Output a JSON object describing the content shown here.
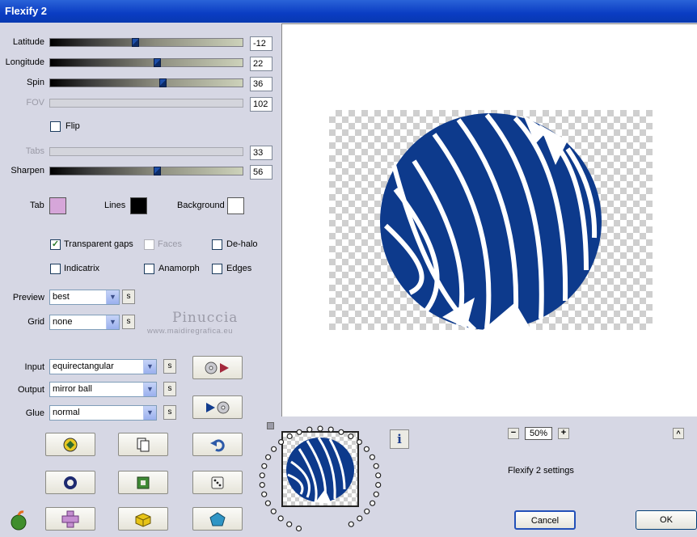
{
  "window": {
    "title": "Flexify 2"
  },
  "sliders": [
    {
      "label": "Latitude",
      "value": "-12",
      "fraction": 0.44,
      "enabled": true
    },
    {
      "label": "Longitude",
      "value": "22",
      "fraction": 0.56,
      "enabled": true
    },
    {
      "label": "Spin",
      "value": "36",
      "fraction": 0.59,
      "enabled": true
    },
    {
      "label": "FOV",
      "value": "102",
      "enabled": false
    },
    {
      "label": "Tabs",
      "value": "33",
      "enabled": false
    },
    {
      "label": "Sharpen",
      "value": "56",
      "fraction": 0.56,
      "enabled": true
    }
  ],
  "flip": {
    "label": "Flip",
    "checked": false
  },
  "colors": {
    "tab": {
      "label": "Tab",
      "value": "#d6a6d9"
    },
    "lines": {
      "label": "Lines",
      "value": "#000000"
    },
    "background": {
      "label": "Background",
      "value": "#ffffff"
    }
  },
  "options": {
    "transparent_gaps": {
      "label": "Transparent gaps",
      "checked": true
    },
    "faces": {
      "label": "Faces",
      "checked": false
    },
    "de_halo": {
      "label": "De-halo",
      "checked": false
    },
    "indicatrix": {
      "label": "Indicatrix",
      "checked": false
    },
    "anamorph": {
      "label": "Anamorph",
      "checked": false
    },
    "edges": {
      "label": "Edges",
      "checked": false
    }
  },
  "dropdowns": {
    "preview": {
      "label": "Preview",
      "value": "best"
    },
    "grid": {
      "label": "Grid",
      "value": "none"
    },
    "input": {
      "label": "Input",
      "value": "equirectangular"
    },
    "output": {
      "label": "Output",
      "value": "mirror ball"
    },
    "glue": {
      "label": "Glue",
      "value": "normal"
    }
  },
  "small_button_label": "s",
  "watermark": {
    "name": "Pinuccia",
    "site": "www.maidiregrafica.eu"
  },
  "zoom": {
    "value": "50%",
    "minus": "−",
    "plus": "+"
  },
  "status_text": "Flexify 2 settings",
  "buttons": {
    "cancel": "Cancel",
    "ok": "OK",
    "collapse": "^",
    "info": "i"
  },
  "accent_colors": {
    "globe": "#0d3a8c",
    "title": "#0a3cc3"
  }
}
